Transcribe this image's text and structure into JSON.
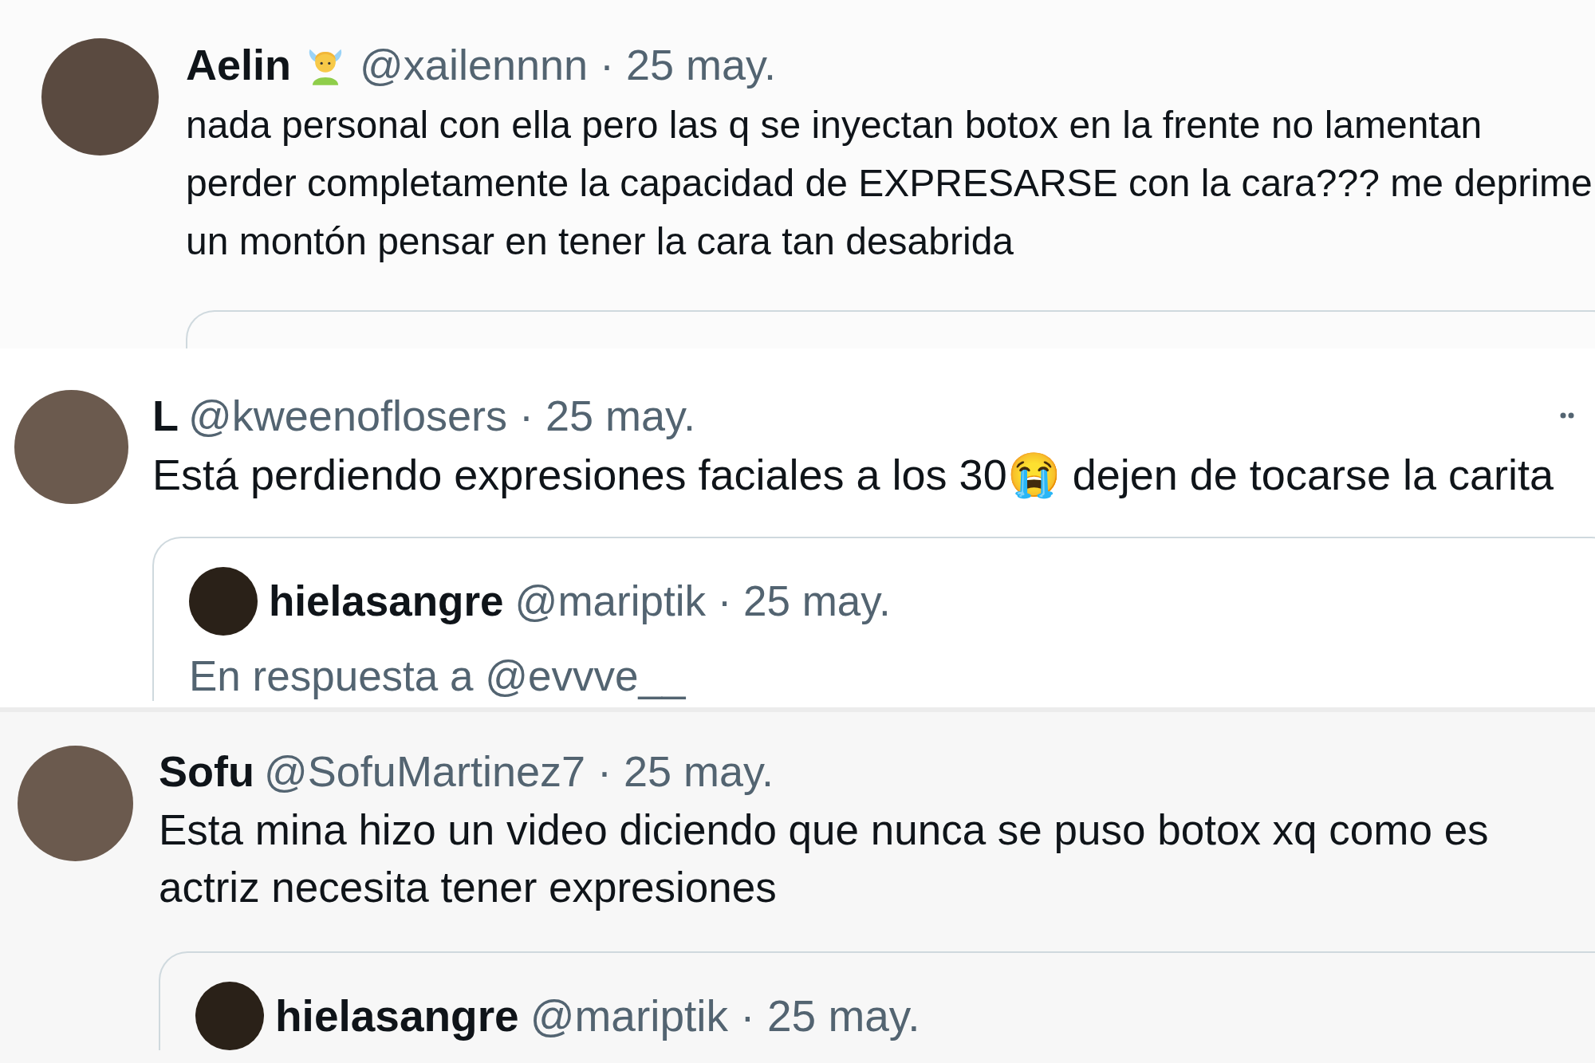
{
  "tweets": [
    {
      "name": "Aelin",
      "has_emoji": true,
      "handle": "@xailennnn",
      "date": "· 25 may.",
      "body": "nada personal con ella pero las q se inyectan botox en la frente no lamentan perder completamente la capacidad de EXPRESARSE con la cara??? me deprime un montón pensar en tener la cara tan desabrida",
      "more": false
    },
    {
      "name": "L",
      "has_emoji": false,
      "handle": "@kweenoflosers",
      "date": "· 25 may.",
      "body": "Está perdiendo expresiones faciales a los 30😭 dejen de tocarse la carita",
      "more": true,
      "quote": {
        "name": "hielasangre",
        "handle": "@mariptik",
        "date": "· 25 may.",
        "reply_to": "En respuesta a @evvve__"
      }
    },
    {
      "name": "Sofu",
      "has_emoji": false,
      "handle": "@SofuMartinez7",
      "date": "· 25 may.",
      "body": "Esta mina hizo un video diciendo que nunca se puso botox xq como es actriz necesita tener expresiones",
      "more": false,
      "quote": {
        "name": "hielasangre",
        "handle": "@mariptik",
        "date": "· 25 may."
      }
    }
  ]
}
